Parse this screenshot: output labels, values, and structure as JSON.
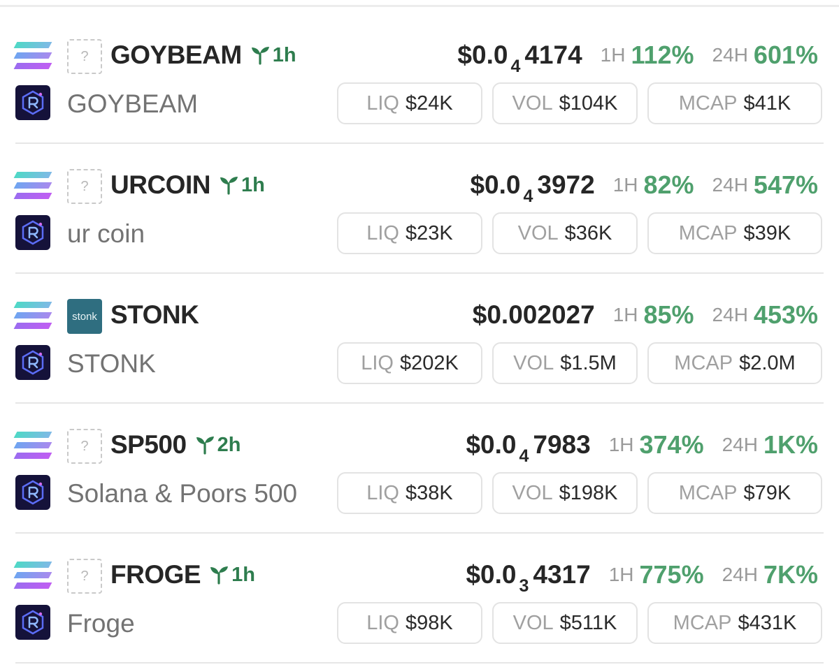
{
  "rows": [
    {
      "symbol": "GOYBEAM",
      "age": "1h",
      "name": "GOYBEAM",
      "image": "placeholder",
      "price": {
        "prefix": "$0.0",
        "zeros": "4",
        "digits": "4174"
      },
      "h1_label": "1H",
      "h1": "112%",
      "h24_label": "24H",
      "h24": "601%",
      "liq_label": "LIQ",
      "liq": "$24K",
      "vol_label": "VOL",
      "vol": "$104K",
      "mcap_label": "MCAP",
      "mcap": "$41K"
    },
    {
      "symbol": "URCOIN",
      "age": "1h",
      "name": "ur coin",
      "image": "placeholder",
      "price": {
        "prefix": "$0.0",
        "zeros": "4",
        "digits": "3972"
      },
      "h1_label": "1H",
      "h1": "82%",
      "h24_label": "24H",
      "h24": "547%",
      "liq_label": "LIQ",
      "liq": "$23K",
      "vol_label": "VOL",
      "vol": "$36K",
      "mcap_label": "MCAP",
      "mcap": "$39K"
    },
    {
      "symbol": "STONK",
      "age": "",
      "name": "STONK",
      "image": "stonk",
      "image_text": "stonk",
      "price": {
        "prefix": "$0.002027",
        "zeros": "",
        "digits": ""
      },
      "h1_label": "1H",
      "h1": "85%",
      "h24_label": "24H",
      "h24": "453%",
      "liq_label": "LIQ",
      "liq": "$202K",
      "vol_label": "VOL",
      "vol": "$1.5M",
      "mcap_label": "MCAP",
      "mcap": "$2.0M"
    },
    {
      "symbol": "SP500",
      "age": "2h",
      "name": "Solana & Poors 500",
      "image": "placeholder",
      "price": {
        "prefix": "$0.0",
        "zeros": "4",
        "digits": "7983"
      },
      "h1_label": "1H",
      "h1": "374%",
      "h24_label": "24H",
      "h24": "1K%",
      "liq_label": "LIQ",
      "liq": "$38K",
      "vol_label": "VOL",
      "vol": "$198K",
      "mcap_label": "MCAP",
      "mcap": "$79K"
    },
    {
      "symbol": "FROGE",
      "age": "1h",
      "name": "Froge",
      "image": "placeholder",
      "price": {
        "prefix": "$0.0",
        "zeros": "3",
        "digits": "4317"
      },
      "h1_label": "1H",
      "h1": "775%",
      "h24_label": "24H",
      "h24": "7K%",
      "liq_label": "LIQ",
      "liq": "$98K",
      "vol_label": "VOL",
      "vol": "$511K",
      "mcap_label": "MCAP",
      "mcap": "$431K"
    }
  ],
  "placeholder_glyph": "?",
  "colors": {
    "positive": "#4fa06d",
    "age": "#2e7d4e",
    "dex_bg": "#15123a"
  },
  "icons": {
    "chain": "solana-icon",
    "dex": "raydium-icon",
    "age": "sprout-icon",
    "placeholder": "question-mark-icon"
  }
}
